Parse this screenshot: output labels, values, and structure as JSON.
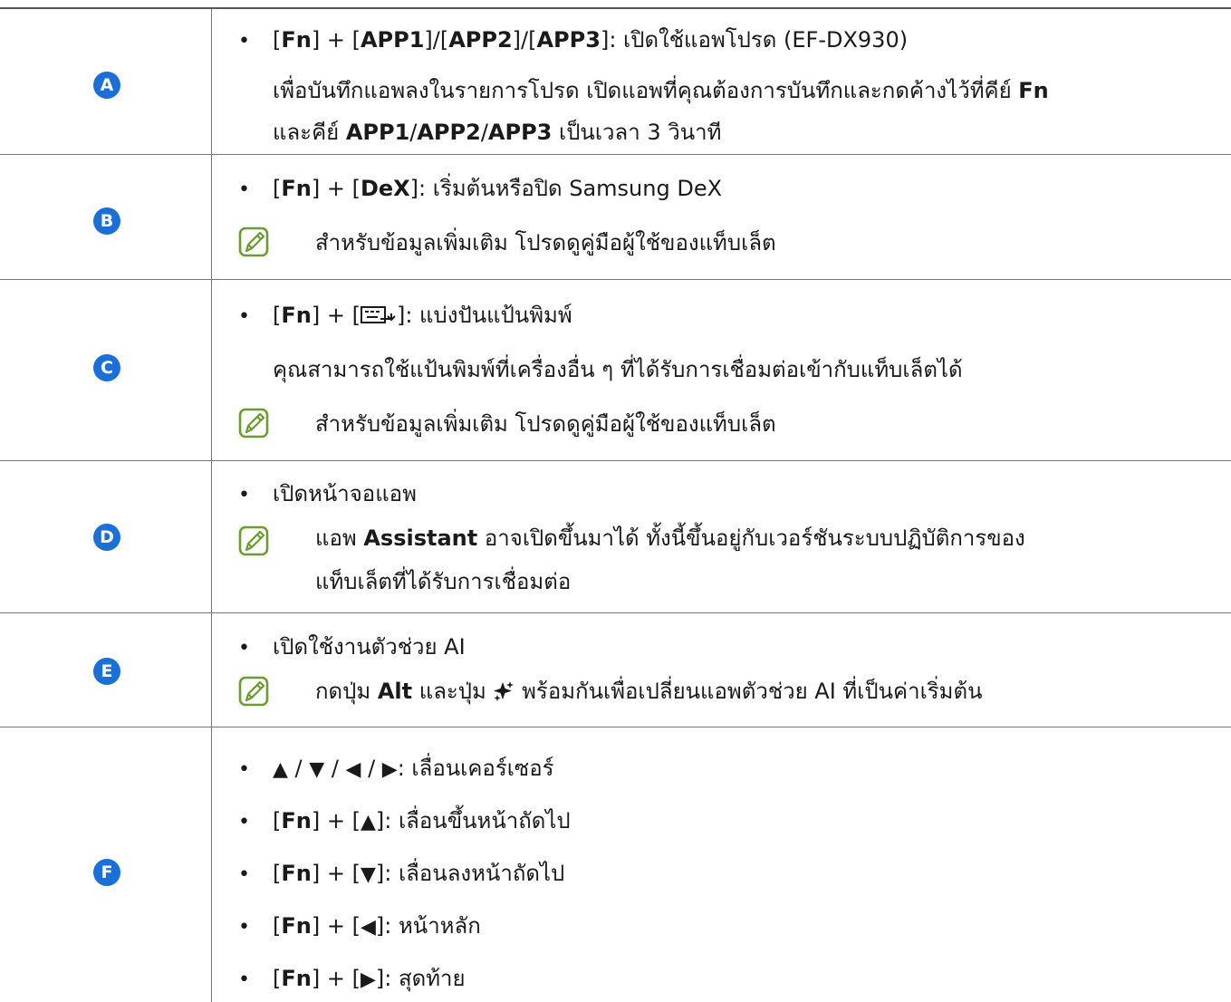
{
  "rows": [
    {
      "id": "A",
      "bullet": {
        "fn": "Fn",
        "app1": "APP1",
        "app2": "APP2",
        "app3": "APP3",
        "text": ": เปิดใช้แอพโปรด (EF-DX930)"
      },
      "para_line1": {
        "text": "เพื่อบันทึกแอพลงในรายการโปรด เปิดแอพที่คุณต้องการบันทึกและกดค้างไว้ที่คีย์ ",
        "fn": "Fn"
      },
      "para_line2": {
        "pre": "และคีย์ ",
        "app1": "APP1",
        "app2": "APP2",
        "app3": "APP3",
        "post": " เป็นเวลา 3 วินาที"
      }
    },
    {
      "id": "B",
      "bullet": {
        "fn": "Fn",
        "key": "DeX",
        "text": ": เริ่มต้นหรือปิด Samsung DeX"
      },
      "note": "สำหรับข้อมูลเพิ่มเติม โปรดดูคู่มือผู้ใช้ของแท็บเล็ต"
    },
    {
      "id": "C",
      "bullet": {
        "fn": "Fn",
        "text": ": แบ่งปันแป้นพิมพ์"
      },
      "para": "คุณสามารถใช้แป้นพิมพ์ที่เครื่องอื่น ๆ ที่ได้รับการเชื่อมต่อเข้ากับแท็บเล็ตได้",
      "note": "สำหรับข้อมูลเพิ่มเติม โปรดดูคู่มือผู้ใช้ของแท็บเล็ต"
    },
    {
      "id": "D",
      "bullet": {
        "text": "เปิดหน้าจอแอพ"
      },
      "note_line1": {
        "pre": "แอพ ",
        "bold": "Assistant",
        "post": " อาจเปิดขึ้นมาได้ ทั้งนี้ขึ้นอยู่กับเวอร์ชันระบบปฏิบัติการของ"
      },
      "note_line2": "แท็บเล็ตที่ได้รับการเชื่อมต่อ"
    },
    {
      "id": "E",
      "bullet": {
        "text": "เปิดใช้งานตัวช่วย AI"
      },
      "note": {
        "pre": "กดปุ่ม ",
        "bold": "Alt",
        "mid": " และปุ่ม ",
        "post": " พร้อมกันเพื่อเปลี่ยนแอพตัวช่วย AI ที่เป็นค่าเริ่มต้น"
      }
    },
    {
      "id": "F",
      "items": [
        {
          "text": ": เลื่อนเคอร์เซอร์"
        },
        {
          "fn": "Fn",
          "text": ": เลื่อนขึ้นหน้าถัดไป"
        },
        {
          "fn": "Fn",
          "text": ": เลื่อนลงหน้าถัดไป"
        },
        {
          "fn": "Fn",
          "text": ": หน้าหลัก"
        },
        {
          "fn": "Fn",
          "text": ": สุดท้าย"
        }
      ]
    }
  ],
  "colors": {
    "label_bg": "#1a6fd8",
    "note_icon": "#6a9c2f",
    "text": "#1a1a1a"
  },
  "icons": [
    "note-pencil-icon",
    "share-keyboard-icon",
    "ai-sparkle-icon"
  ]
}
